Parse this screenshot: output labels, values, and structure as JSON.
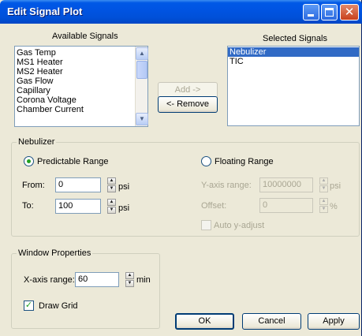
{
  "window": {
    "title": "Edit Signal Plot"
  },
  "available": {
    "heading": "Available Signals",
    "items": [
      "Gas Temp",
      "MS1 Heater",
      "MS2 Heater",
      "Gas Flow",
      "Capillary",
      "Corona Voltage",
      "Chamber Current"
    ]
  },
  "selected": {
    "heading": "Selected Signals",
    "items": [
      "Nebulizer",
      "TIC"
    ]
  },
  "buttons": {
    "add": "Add ->",
    "remove": "<- Remove",
    "ok": "OK",
    "cancel": "Cancel",
    "apply": "Apply"
  },
  "nebulizer": {
    "group_title": "Nebulizer",
    "predictable_label": "Predictable Range",
    "floating_label": "Floating Range",
    "range_mode": "predictable",
    "from_label": "From:",
    "from_value": "0",
    "from_unit": "psi",
    "to_label": "To:",
    "to_value": "100",
    "to_unit": "psi",
    "y_axis_label": "Y-axis range:",
    "y_axis_value": "10000000",
    "y_axis_unit": "psi",
    "offset_label": "Offset:",
    "offset_value": "0",
    "offset_unit": "%",
    "auto_adjust_label": "Auto y-adjust"
  },
  "window_props": {
    "group_title": "Window Properties",
    "x_axis_label": "X-axis range:",
    "x_axis_value": "60",
    "x_axis_unit": "min",
    "draw_grid_label": "Draw Grid",
    "draw_grid_checked": true
  },
  "colors": {
    "titlebar": "#0054e3",
    "selection": "#316ac5",
    "dialog_bg": "#ece9d8"
  }
}
